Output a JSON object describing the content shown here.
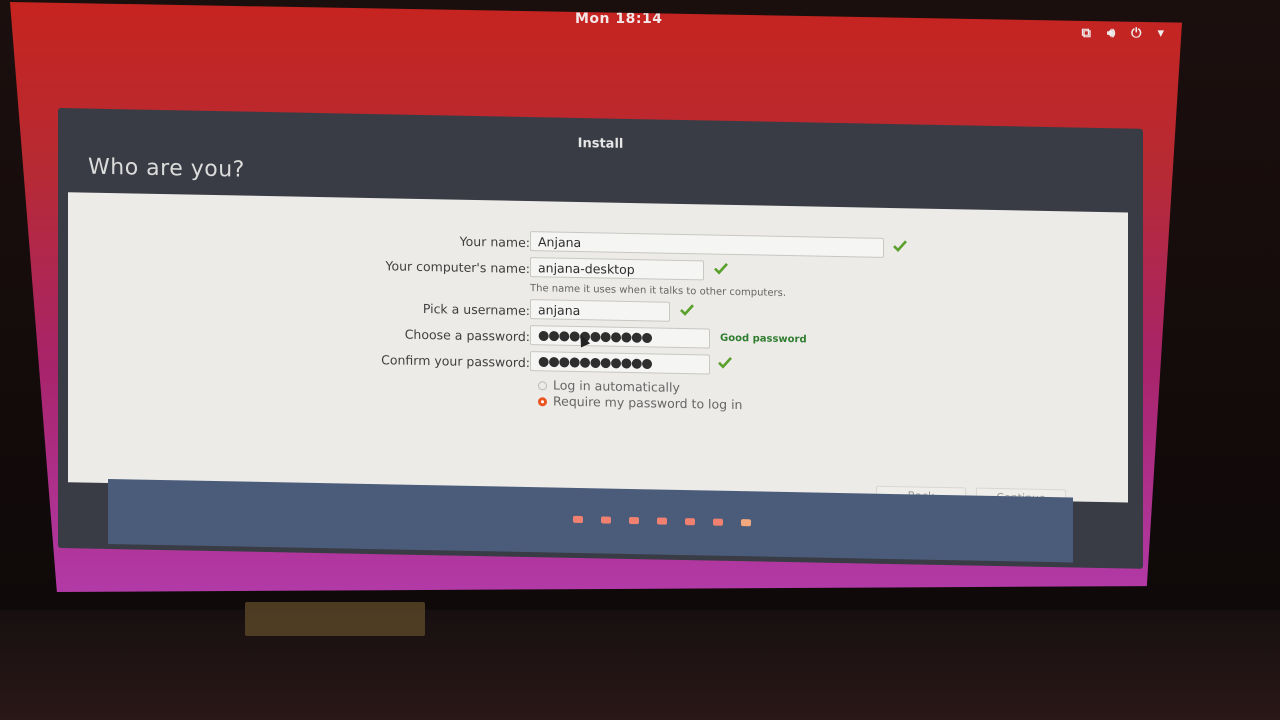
{
  "topbar": {
    "clock": "Mon 18:14"
  },
  "window": {
    "title": "Install",
    "heading": "Who are you?"
  },
  "form": {
    "your_name": {
      "label": "Your name:",
      "value": "Anjana"
    },
    "computer_name": {
      "label": "Your computer's name:",
      "value": "anjana-desktop",
      "hint": "The name it uses when it talks to other computers."
    },
    "username": {
      "label": "Pick a username:",
      "value": "anjana"
    },
    "password": {
      "label": "Choose a password:",
      "value": "●●●●●●●●●●●",
      "strength": "Good password"
    },
    "confirm": {
      "label": "Confirm your password:",
      "value": "●●●●●●●●●●●"
    },
    "login_options": [
      {
        "label": "Log in automatically",
        "selected": false
      },
      {
        "label": "Require my password to log in",
        "selected": true
      }
    ]
  },
  "buttons": {
    "back": "Back",
    "continue": "Continue"
  },
  "progress": {
    "total_steps": 7,
    "current_step": 7
  },
  "colors": {
    "accent": "#e95420",
    "check": "#5aa02c",
    "footer": "#4b5c7a"
  }
}
